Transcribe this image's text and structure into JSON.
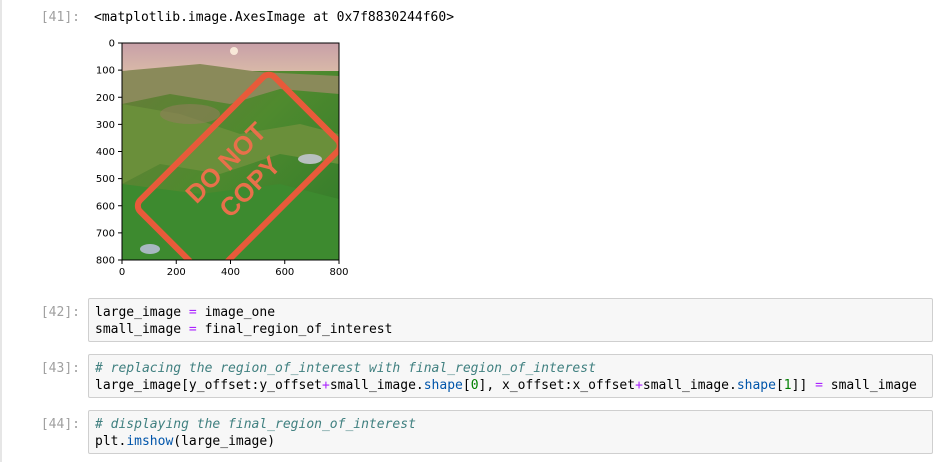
{
  "output_41": {
    "prompt": "[41]:",
    "text": "<matplotlib.image.AxesImage at 0x7f8830244f60>"
  },
  "chart_data": {
    "type": "image",
    "xticks": [
      "0",
      "200",
      "400",
      "600",
      "800"
    ],
    "yticks": [
      "0",
      "100",
      "200",
      "300",
      "400",
      "500",
      "600",
      "700",
      "800"
    ],
    "xlim": [
      0,
      800
    ],
    "ylim": [
      800,
      0
    ],
    "stamp_text": [
      "DO NOT",
      "COPY"
    ]
  },
  "cells": [
    {
      "prompt": "[42]:",
      "lines": [
        {
          "a": "large_image",
          "op": " = ",
          "b": "image_one"
        },
        {
          "a": "small_image",
          "op": " = ",
          "b": "final_region_of_interest"
        }
      ]
    },
    {
      "prompt": "[43]:",
      "comment": "# replacing the region_of_interest with final_region_of_interest",
      "code": {
        "p1": "large_image[y_offset:y_offset",
        "plus1": "+",
        "p2": "small_image.",
        "attr1": "shape",
        "p3": "[",
        "n0": "0",
        "p4": "], x_offset:x_offset",
        "plus2": "+",
        "p5": "small_image.",
        "attr2": "shape",
        "p6": "[",
        "n1": "1",
        "p7": "]] ",
        "eq": "=",
        "p8": " small_image"
      }
    },
    {
      "prompt": "[44]:",
      "comment": "# displaying the final_region_of_interest",
      "code": {
        "obj": "plt.",
        "fn": "imshow",
        "args": "(large_image)"
      }
    }
  ]
}
